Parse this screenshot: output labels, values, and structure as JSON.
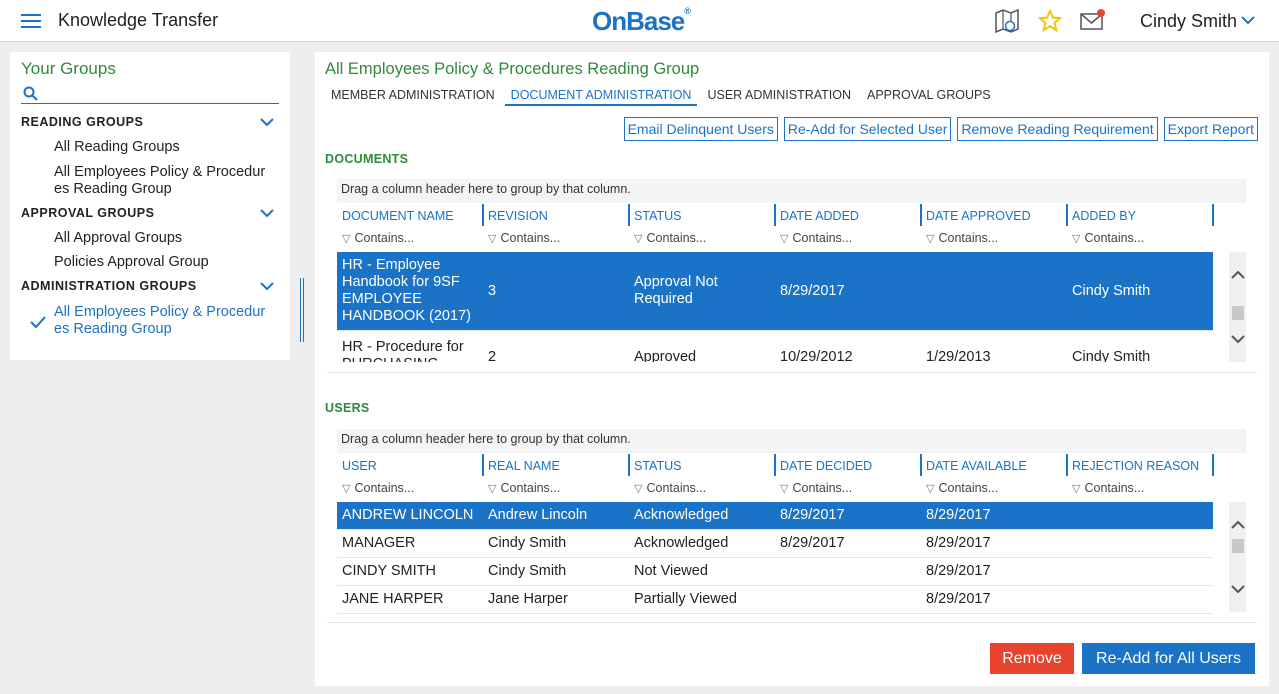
{
  "header": {
    "app_title": "Knowledge Transfer",
    "logo_text": "OnBase",
    "user_name": "Cindy Smith",
    "icons": [
      "menu-icon",
      "map-icon",
      "star-icon",
      "mail-icon",
      "chevron-down-icon"
    ],
    "colors": {
      "accent": "#1a73c7",
      "star": "#f5c400",
      "notification": "#e8432d"
    }
  },
  "sidebar": {
    "title": "Your Groups",
    "search_placeholder": "",
    "sections": [
      {
        "label": "READING GROUPS",
        "items": [
          "All Reading Groups",
          "All Employees Policy & Procedur es Reading Group"
        ]
      },
      {
        "label": "APPROVAL GROUPS",
        "items": [
          "All Approval Groups",
          "Policies Approval Group"
        ]
      },
      {
        "label": "ADMINISTRATION GROUPS",
        "items": [
          "All Employees Policy & Procedur es Reading Group"
        ]
      }
    ]
  },
  "main": {
    "title": "All Employees Policy & Procedures Reading Group",
    "tabs": [
      "MEMBER ADMINISTRATION",
      "DOCUMENT ADMINISTRATION",
      "USER ADMINISTRATION",
      "APPROVAL GROUPS"
    ],
    "active_tab": "DOCUMENT ADMINISTRATION",
    "actions": [
      "Email Delinquent Users",
      "Re-Add for Selected User",
      "Remove Reading Requirement",
      "Export Report"
    ],
    "documents": {
      "label": "DOCUMENTS",
      "group_hint": "Drag a column header here to group by that column.",
      "columns": [
        "DOCUMENT NAME",
        "REVISION",
        "STATUS",
        "DATE ADDED",
        "DATE APPROVED",
        "ADDED BY"
      ],
      "filter_placeholder": "Contains...",
      "rows": [
        [
          "HR - Employee Handbook for 9SF EMPLOYEE HANDBOOK (2017)",
          "3",
          "Approval Not Required",
          "8/29/2017",
          "",
          "Cindy Smith"
        ],
        [
          "HR - Procedure for PURCHASING",
          "2",
          "Approved",
          "10/29/2012",
          "1/29/2013",
          "Cindy Smith"
        ]
      ]
    },
    "users": {
      "label": "USERS",
      "group_hint": "Drag a column header here to group by that column.",
      "columns": [
        "USER",
        "REAL NAME",
        "STATUS",
        "DATE DECIDED",
        "DATE AVAILABLE",
        "REJECTION REASON"
      ],
      "filter_placeholder": "Contains...",
      "rows": [
        [
          "ANDREW LINCOLN",
          "Andrew Lincoln",
          "Acknowledged",
          "8/29/2017",
          "8/29/2017",
          ""
        ],
        [
          "MANAGER",
          "Cindy Smith",
          "Acknowledged",
          "8/29/2017",
          "8/29/2017",
          ""
        ],
        [
          "CINDY SMITH",
          "Cindy Smith",
          "Not Viewed",
          "",
          "8/29/2017",
          ""
        ],
        [
          "JANE HARPER",
          "Jane Harper",
          "Partially Viewed",
          "",
          "8/29/2017",
          ""
        ]
      ]
    },
    "remove_label": "Remove",
    "readd_all_label": "Re-Add for All Users"
  }
}
